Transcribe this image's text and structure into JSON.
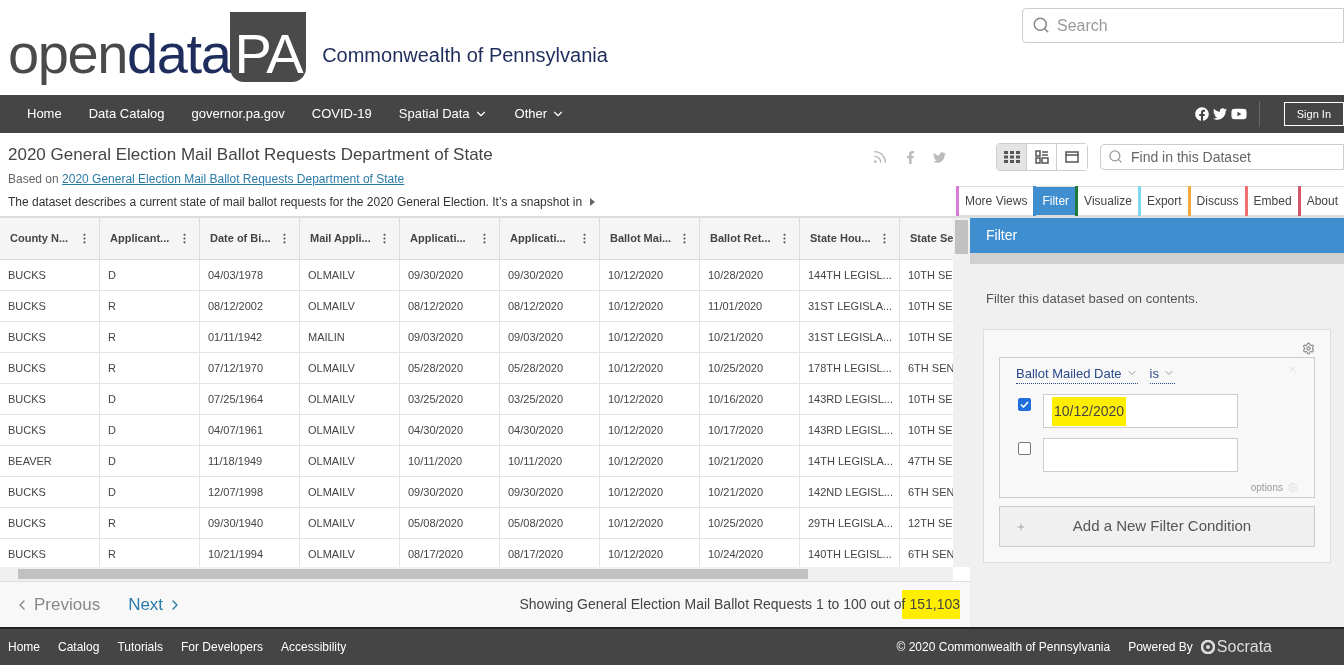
{
  "header": {
    "logo": {
      "open": "open",
      "data": "data",
      "pa": "PA"
    },
    "org": "Commonwealth of Pennsylvania",
    "search": {
      "placeholder": "Search"
    }
  },
  "nav": {
    "items": [
      {
        "label": "Home",
        "dropdown": false
      },
      {
        "label": "Data Catalog",
        "dropdown": false
      },
      {
        "label": "governor.pa.gov",
        "dropdown": false
      },
      {
        "label": "COVID-19",
        "dropdown": false
      },
      {
        "label": "Spatial Data",
        "dropdown": true
      },
      {
        "label": "Other",
        "dropdown": true
      }
    ],
    "sign_in": "Sign In"
  },
  "dataset": {
    "title": "2020 General Election Mail Ballot Requests Department of State",
    "based_on": "Based on",
    "based_link": "2020 General Election Mail Ballot Requests Department of State",
    "description": "The dataset describes a current state of mail ballot requests for the 2020 General Election. It’s a snapshot in",
    "find": {
      "placeholder": "Find in this Dataset"
    },
    "views": [
      {
        "kind": "grid",
        "selected": true
      },
      {
        "kind": "list",
        "selected": false
      },
      {
        "kind": "page",
        "selected": false
      }
    ],
    "tabs": [
      {
        "label": "More Views",
        "selected": false,
        "color": "#d97ad9"
      },
      {
        "label": "Filter",
        "selected": true,
        "color": "#3f8fd0"
      },
      {
        "label": "Visualize",
        "selected": false,
        "color": "#1f7a3a"
      },
      {
        "label": "Export",
        "selected": false,
        "color": "#7fd8f0"
      },
      {
        "label": "Discuss",
        "selected": false,
        "color": "#f0a840"
      },
      {
        "label": "Embed",
        "selected": false,
        "color": "#f07070"
      },
      {
        "label": "About",
        "selected": false,
        "color": "#d05868"
      }
    ]
  },
  "table": {
    "columns": [
      "County N...",
      "Applicant...",
      "Date of Bi...",
      "Mail Appli...",
      "Applicati...",
      "Applicati...",
      "Ballot Mai...",
      "Ballot Ret...",
      "State Hou...",
      "State Se"
    ],
    "rows": [
      [
        "BUCKS",
        "D",
        "04/03/1978",
        "OLMAILV",
        "09/30/2020",
        "09/30/2020",
        "10/12/2020",
        "10/28/2020",
        "144TH LEGISL...",
        "10TH SE"
      ],
      [
        "BUCKS",
        "R",
        "08/12/2002",
        "OLMAILV",
        "08/12/2020",
        "08/12/2020",
        "10/12/2020",
        "11/01/2020",
        "31ST LEGISLA...",
        "10TH SE"
      ],
      [
        "BUCKS",
        "R",
        "01/11/1942",
        "MAILIN",
        "09/03/2020",
        "09/03/2020",
        "10/12/2020",
        "10/21/2020",
        "31ST LEGISLA...",
        "10TH SE"
      ],
      [
        "BUCKS",
        "R",
        "07/12/1970",
        "OLMAILV",
        "05/28/2020",
        "05/28/2020",
        "10/12/2020",
        "10/25/2020",
        "178TH LEGISL...",
        "6TH SEN"
      ],
      [
        "BUCKS",
        "D",
        "07/25/1964",
        "OLMAILV",
        "03/25/2020",
        "03/25/2020",
        "10/12/2020",
        "10/16/2020",
        "143RD LEGISL...",
        "10TH SE"
      ],
      [
        "BUCKS",
        "D",
        "04/07/1961",
        "OLMAILV",
        "04/30/2020",
        "04/30/2020",
        "10/12/2020",
        "10/17/2020",
        "143RD LEGISL...",
        "10TH SE"
      ],
      [
        "BEAVER",
        "D",
        "11/18/1949",
        "OLMAILV",
        "10/11/2020",
        "10/11/2020",
        "10/12/2020",
        "10/21/2020",
        "14TH LEGISLA...",
        "47TH SE"
      ],
      [
        "BUCKS",
        "D",
        "12/07/1998",
        "OLMAILV",
        "09/30/2020",
        "09/30/2020",
        "10/12/2020",
        "10/21/2020",
        "142ND LEGISL...",
        "6TH SEN"
      ],
      [
        "BUCKS",
        "R",
        "09/30/1940",
        "OLMAILV",
        "05/08/2020",
        "05/08/2020",
        "10/12/2020",
        "10/25/2020",
        "29TH LEGISLA...",
        "12TH SE"
      ],
      [
        "BUCKS",
        "R",
        "10/21/1994",
        "OLMAILV",
        "08/17/2020",
        "08/17/2020",
        "10/12/2020",
        "10/24/2020",
        "140TH LEGISL...",
        "6TH SEN"
      ]
    ]
  },
  "pager": {
    "previous": "Previous",
    "next": "Next",
    "status": "Showing General Election Mail Ballot Requests 1 to 100 out o",
    "count": "f 151,103"
  },
  "filter": {
    "title": "Filter",
    "intro": "Filter this dataset based on contents.",
    "column": "Ballot Mailed Date",
    "operator": "is",
    "values": [
      {
        "checked": true,
        "value": "10/12/2020"
      },
      {
        "checked": false
      }
    ],
    "options": "options",
    "add": "Add a New Filter Condition"
  },
  "footer": {
    "links": [
      "Home",
      "Catalog",
      "Tutorials",
      "For Developers",
      "Accessibility"
    ],
    "copyright": "© 2020 Commonwealth of Pennsylvania",
    "powered": "Powered By",
    "brand": "Socrata"
  }
}
